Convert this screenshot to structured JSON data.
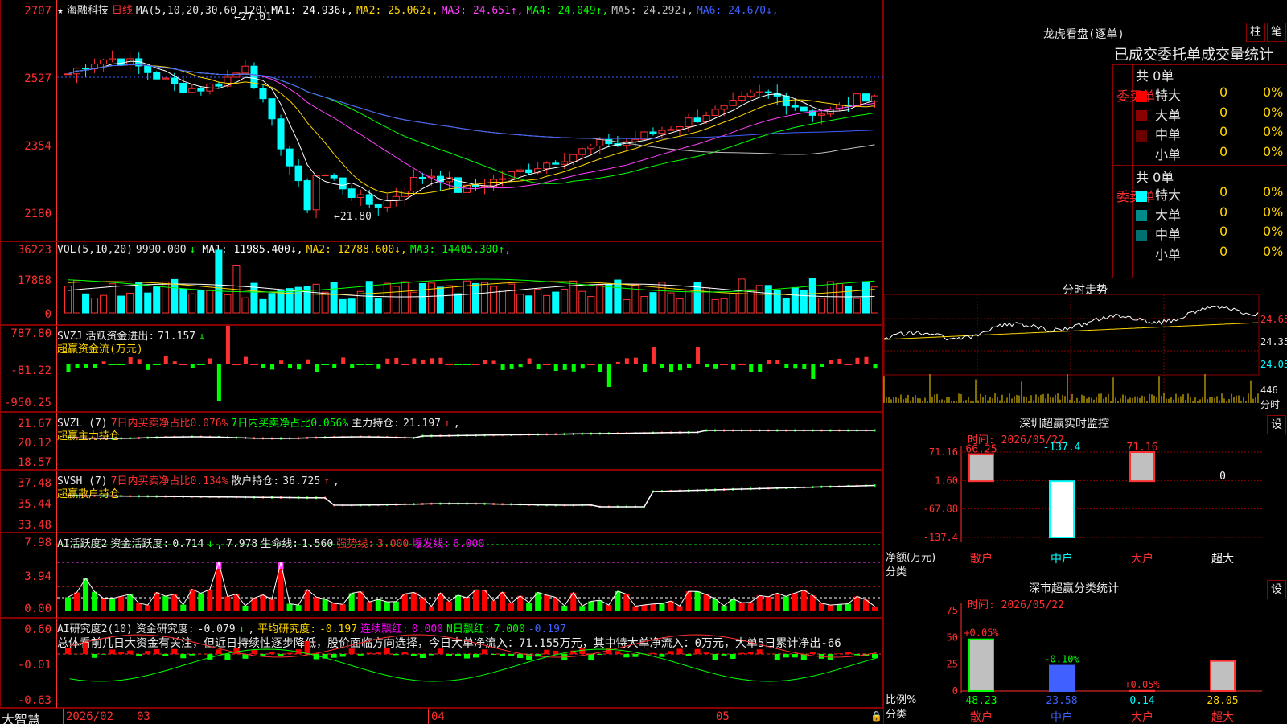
{
  "stock": {
    "name": "海融科技",
    "period": "日线",
    "star_icon": "star-icon"
  },
  "main": {
    "ma_title": "MA(5,10,20,30,60,120)",
    "ma": [
      {
        "label": "MA1:",
        "value": "24.936",
        "arrow": "↓",
        "color": "#ffffff"
      },
      {
        "label": "MA2:",
        "value": "25.062",
        "arrow": "↓",
        "color": "#ffd700"
      },
      {
        "label": "MA3:",
        "value": "24.651",
        "arrow": "↑",
        "color": "#ff40ff"
      },
      {
        "label": "MA4:",
        "value": "24.049",
        "arrow": "↑",
        "color": "#00ff00"
      },
      {
        "label": "MA5:",
        "value": "24.292",
        "arrow": "↓",
        "color": "#c0c0c0"
      },
      {
        "label": "MA6:",
        "value": "24.670",
        "arrow": "↓",
        "color": "#4060ff"
      }
    ],
    "yticks": [
      "2707",
      "2527",
      "2354",
      "2180"
    ],
    "high_mark": "27.01",
    "low_mark": "21.80"
  },
  "vol": {
    "title": "VOL(5,10,20)",
    "value": "9990.000",
    "arrow": "↓",
    "ma": [
      {
        "label": "MA1:",
        "value": "11985.400",
        "arrow": "↓",
        "color": "#ffffff"
      },
      {
        "label": "MA2:",
        "value": "12788.600",
        "arrow": "↓",
        "color": "#ffd700"
      },
      {
        "label": "MA3:",
        "value": "14405.300",
        "arrow": "↑",
        "color": "#00ff00"
      }
    ],
    "yticks": [
      "36223",
      "17888",
      "0"
    ]
  },
  "svzj": {
    "title": "SVZJ",
    "label": "活跃资金进出:",
    "value": "71.157",
    "arrow": "↓",
    "sub": "超赢资金流(万元)",
    "yticks": [
      "787.80",
      "-81.22",
      "-950.25"
    ]
  },
  "svzl": {
    "title": "SVZL (7)",
    "l1": "7日内买卖净占比0.076%",
    "l2": "7日内买卖净占比0.056%",
    "l3": "主力持仓:",
    "value": "21.197",
    "arrow": "↑",
    "sub": "超赢主力持仓",
    "yticks": [
      "21.67",
      "20.12",
      "18.57"
    ]
  },
  "svsh": {
    "title": "SVSH (7)",
    "l1": "7日内买卖净占比0.134%",
    "l3": "散户持仓:",
    "value": "36.725",
    "arrow": "↑",
    "sub": "超赢散户持仓",
    "yticks": [
      "37.48",
      "35.44",
      "33.48"
    ]
  },
  "ai1": {
    "title": "AI活跃度2",
    "l1": "资金活跃度:",
    "v1": "0.714",
    "a1": "↓",
    "v2": "7.978",
    "l3": "生命线:",
    "v3": "1.560",
    "l4": "强势线:",
    "v4": "3.000",
    "l5": "爆发线:",
    "v5": "6.000",
    "yticks": [
      "7.98",
      "3.94",
      "0.00"
    ]
  },
  "ai2": {
    "title": "AI研究度2(10)",
    "l1": "资金研究度:",
    "v1": "-0.079",
    "a1": "↓",
    "l2": "平均研究度:",
    "v2": "-0.197",
    "l3": "连续飘红:",
    "v3": "0.000",
    "l4": "N日飘红:",
    "v4": "7.000",
    "v5": "-0.197",
    "text": "总体看前几日大资金有关注，但近日持续性逐步降低，股价面临方向选择，今日大单净流入：71.155万元，其中特大单净流入：0万元，大单5日累计净出-66",
    "yticks": [
      "0.60",
      "-0.01",
      "-0.63"
    ]
  },
  "xaxis": {
    "brand": "大智慧",
    "dates": [
      "2026/02",
      "03",
      "04",
      "05"
    ]
  },
  "lhb": {
    "title": "龙虎看盘(逐单)",
    "btn1": "柱",
    "btn2": "笔",
    "subtitle": "已成交委托单成交量统计",
    "buy": {
      "label": "委买单",
      "count": "共 0单",
      "rows": [
        {
          "name": "特大",
          "v": "0",
          "p": "0%",
          "color": "#ff0000"
        },
        {
          "name": "大单",
          "v": "0",
          "p": "0%",
          "color": "#8b0000"
        },
        {
          "name": "中单",
          "v": "0",
          "p": "0%",
          "color": "#6b0000"
        },
        {
          "name": "小单",
          "v": "0",
          "p": "0%",
          "color": "#000000"
        }
      ]
    },
    "sell": {
      "label": "委卖单",
      "count": "共 0单",
      "rows": [
        {
          "name": "特大",
          "v": "0",
          "p": "0%",
          "color": "#00ffff"
        },
        {
          "name": "大单",
          "v": "0",
          "p": "0%",
          "color": "#008b8b"
        },
        {
          "name": "中单",
          "v": "0",
          "p": "0%",
          "color": "#007070"
        },
        {
          "name": "小单",
          "v": "0",
          "p": "0%",
          "color": "#000000"
        }
      ]
    }
  },
  "fs": {
    "title": "分时走势",
    "p1": "24.65",
    "p2": "24.35",
    "p3": "24.05",
    "vol": "446",
    "vunit": "分时"
  },
  "sz": {
    "title": "深圳超赢实时监控",
    "btn": "设",
    "time_label": "时间:",
    "time": "2026/05/22",
    "yticks": [
      "71.16",
      "1.60",
      "-67.88",
      "-137.4"
    ],
    "ylabel1": "净额(万元)",
    "ylabel2": "分类",
    "bars": [
      {
        "cat": "散户",
        "value": 66.25,
        "label": "66.25"
      },
      {
        "cat": "中户",
        "value": -137.4,
        "label": "-137.4"
      },
      {
        "cat": "大户",
        "value": 71.16,
        "label": "71.16"
      },
      {
        "cat": "超大",
        "value": 0,
        "label": "0"
      }
    ]
  },
  "sm": {
    "title": "深市超赢分类统计",
    "btn": "设",
    "time_label": "时间:",
    "time": "2026/05/22",
    "yticks": [
      "75",
      "50",
      "25",
      "0"
    ],
    "ylabel1": "比例%",
    "ylabel2": "分类",
    "bars": [
      {
        "cat": "散户",
        "value": 48.23,
        "label": "48.23",
        "top": "+0.05%"
      },
      {
        "cat": "中户",
        "value": 23.58,
        "label": "23.58",
        "top": "-0.10%"
      },
      {
        "cat": "大户",
        "value": 0.14,
        "label": "0.14",
        "top": "+0.05%"
      },
      {
        "cat": "超大",
        "value": 28.05,
        "label": "28.05",
        "top": ""
      }
    ]
  },
  "chart_data": {
    "type": "bar",
    "title": "深圳超赢实时监控",
    "categories": [
      "散户",
      "中户",
      "大户",
      "超大"
    ],
    "values": [
      66.25,
      -137.4,
      71.16,
      0
    ],
    "ylim": [
      -137.4,
      71.16
    ],
    "xlabel": "分类",
    "ylabel": "净额(万元)"
  }
}
